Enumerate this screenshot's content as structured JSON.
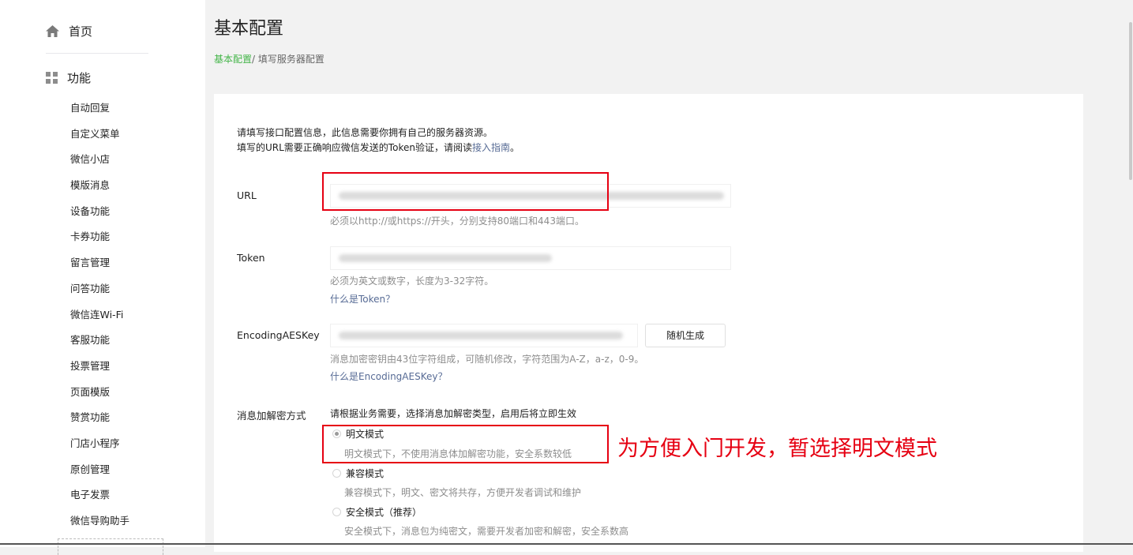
{
  "sidebar": {
    "home": "首页",
    "function_section": "功能",
    "items": [
      "自动回复",
      "自定义菜单",
      "微信小店",
      "模版消息",
      "设备功能",
      "卡券功能",
      "留言管理",
      "问答功能",
      "微信连Wi-Fi",
      "客服功能",
      "投票管理",
      "页面模版",
      "赞赏功能",
      "门店小程序",
      "原创管理",
      "电子发票",
      "微信导购助手"
    ]
  },
  "page": {
    "title": "基本配置",
    "breadcrumb_link": "基本配置",
    "breadcrumb_rest": "/ 填写服务器配置"
  },
  "intro": {
    "line1": "请填写接口配置信息，此信息需要你拥有自己的服务器资源。",
    "line2_prefix": "填写的URL需要正确响应微信发送的Token验证，请阅读",
    "line2_link": "接入指南",
    "line2_suffix": "。"
  },
  "form": {
    "url": {
      "label": "URL",
      "hint": "必须以http://或https://开头，分别支持80端口和443端口。"
    },
    "token": {
      "label": "Token",
      "hint": "必须为英文或数字，长度为3-32字符。",
      "link": "什么是Token？"
    },
    "aeskey": {
      "label": "EncodingAESKey",
      "button": "随机生成",
      "hint": "消息加密密钥由43位字符组成，可随机修改，字符范围为A-Z，a-z，0-9。",
      "link": "什么是EncodingAESKey？"
    },
    "encrypt": {
      "label": "消息加解密方式",
      "hint": "请根据业务需要，选择消息加解密类型，启用后将立即生效",
      "options": [
        {
          "label": "明文模式",
          "desc": "明文模式下，不使用消息体加解密功能，安全系数较低",
          "checked": true
        },
        {
          "label": "兼容模式",
          "desc": "兼容模式下，明文、密文将共存，方便开发者调试和维护",
          "checked": false
        },
        {
          "label": "安全模式（推荐）",
          "desc": "安全模式下，消息包为纯密文，需要开发者加密和解密，安全系数高",
          "checked": false
        }
      ]
    }
  },
  "annotation": "为方便入门开发，暂选择明文模式",
  "colors": {
    "accent_green": "#44b549",
    "link_blue": "#576b95",
    "annotation_red": "#e60012"
  }
}
